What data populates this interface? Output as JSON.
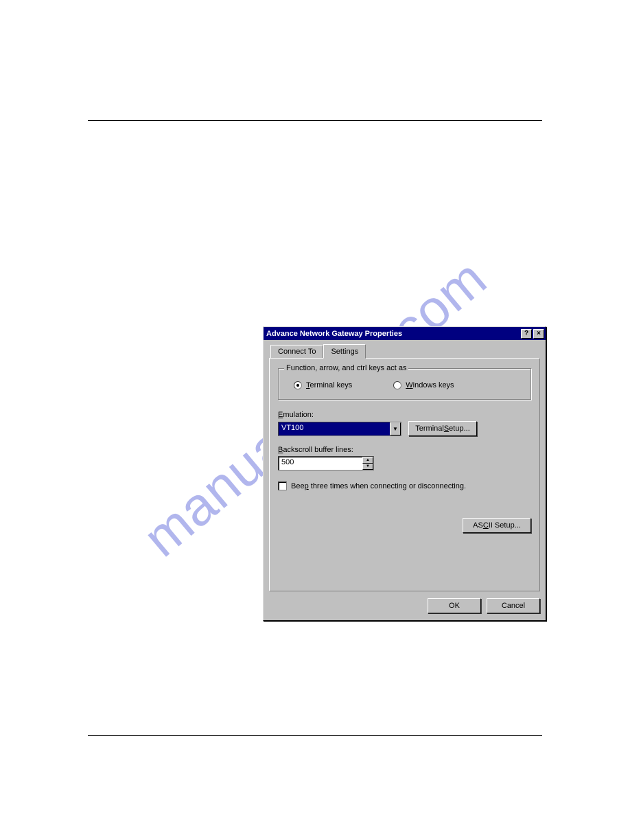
{
  "watermark": "manualshive.com",
  "titlebar": {
    "title": "Advance Network Gateway Properties",
    "help_glyph": "?",
    "close_glyph": "×"
  },
  "tabs": {
    "connect_to": "Connect To",
    "settings": "Settings"
  },
  "keys_group": {
    "label": "Function, arrow, and ctrl keys act as",
    "terminal_prefix": "T",
    "terminal_rest": "erminal keys",
    "windows_prefix": "W",
    "windows_rest": "indows keys"
  },
  "emulation": {
    "label_prefix": "E",
    "label_rest": "mulation:",
    "value": "VT100",
    "button_prefix": "Terminal ",
    "button_underline": "S",
    "button_rest": "etup..."
  },
  "backscroll": {
    "label_prefix": "B",
    "label_rest": "ackscroll buffer lines:",
    "value": "500"
  },
  "beep": {
    "label_prefix": "Bee",
    "label_underline": "p",
    "label_rest": " three times when connecting or disconnecting."
  },
  "ascii": {
    "label_prefix": "AS",
    "label_underline": "C",
    "label_rest": "II Setup..."
  },
  "footer": {
    "ok": "OK",
    "cancel": "Cancel"
  }
}
